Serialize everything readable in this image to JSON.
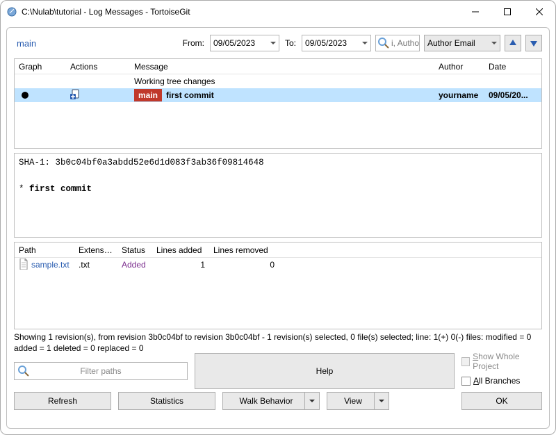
{
  "window": {
    "title": "C:\\Nulab\\tutorial - Log Messages - TortoiseGit"
  },
  "filter": {
    "branch": "main",
    "from_label": "From:",
    "from_value": "09/05/2023",
    "to_label": "To:",
    "to_value": "09/05/2023",
    "search_placeholder": "i, Author, Aut",
    "author_combo": "Author Email"
  },
  "commit_table": {
    "headers": {
      "graph": "Graph",
      "actions": "Actions",
      "message": "Message",
      "author": "Author",
      "date": "Date"
    },
    "working_tree_label": "Working tree changes",
    "rows": [
      {
        "tag": "main",
        "message": "first commit",
        "author": "yourname",
        "date": "09/05/20..."
      }
    ]
  },
  "detail": {
    "sha_prefix": "SHA-1:",
    "sha": "3b0c04bf0a3abdd52e6d1d083f3ab36f09814648",
    "body_prefix": "* ",
    "body": "first commit"
  },
  "file_table": {
    "headers": {
      "path": "Path",
      "ext": "Extension",
      "status": "Status",
      "added": "Lines added",
      "removed": "Lines removed"
    },
    "rows": [
      {
        "path": "sample.txt",
        "ext": ".txt",
        "status": "Added",
        "added": "1",
        "removed": "0"
      }
    ]
  },
  "status": "Showing 1 revision(s), from revision 3b0c04bf to revision 3b0c04bf - 1 revision(s) selected, 0 file(s) selected; line: 1(+) 0(-) files: modified = 0 added = 1 deleted = 0 replaced = 0",
  "controls": {
    "show_whole_project": "Show Whole Project",
    "all_branches": "All Branches",
    "filter_placeholder": "Filter paths",
    "help": "Help",
    "refresh": "Refresh",
    "statistics": "Statistics",
    "walk": "Walk Behavior",
    "view": "View",
    "ok": "OK"
  }
}
